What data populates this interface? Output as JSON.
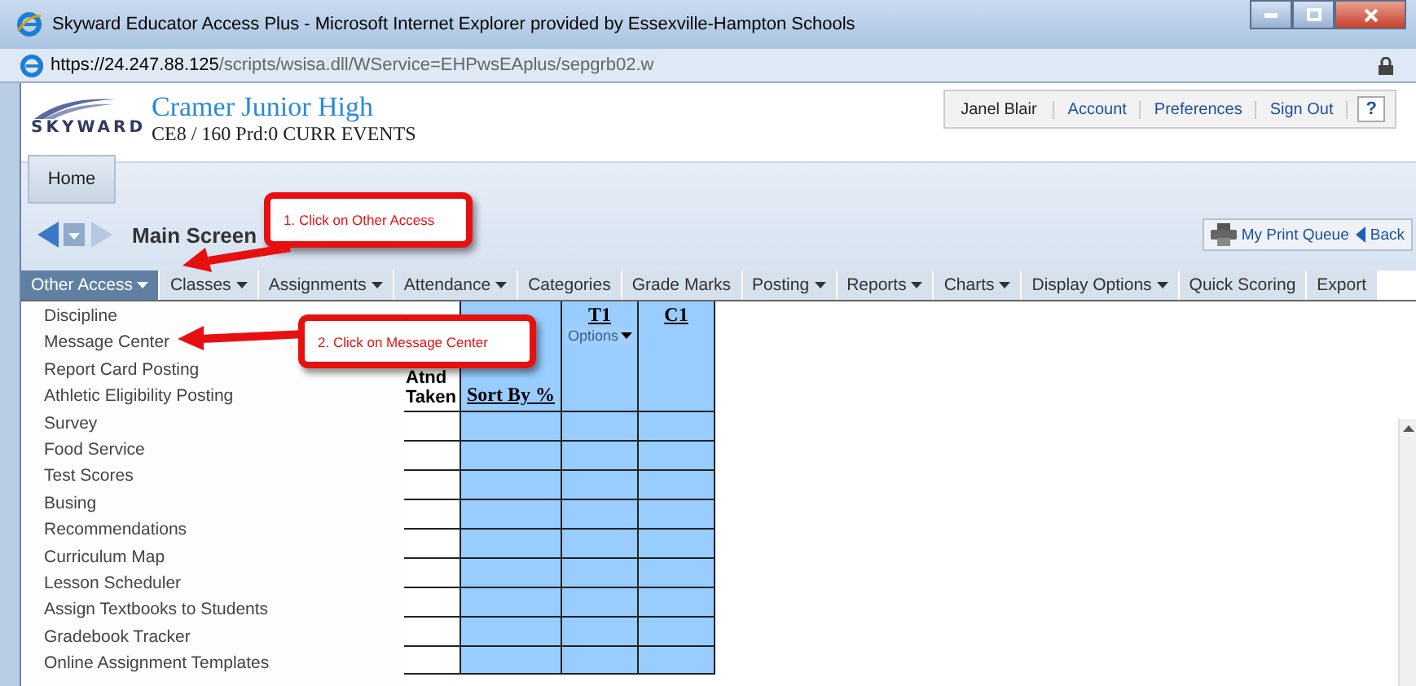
{
  "window": {
    "title": "Skyward Educator Access Plus - Microsoft Internet Explorer provided by Essexville-Hampton Schools"
  },
  "address_bar": {
    "url_host": "https://24.247.88.125",
    "url_path": "/scripts/wsisa.dll/WService=EHPwsEAplus/sepgrb02.w"
  },
  "header": {
    "logo": "SKYWARD",
    "school": "Cramer Junior High",
    "class_info": "CE8 / 160 Prd:0 CURR EVENTS",
    "user_links": [
      {
        "kind": "name",
        "label": "Janel Blair"
      },
      {
        "kind": "link",
        "label": "Account"
      },
      {
        "kind": "link",
        "label": "Preferences"
      },
      {
        "kind": "link",
        "label": "Sign Out"
      },
      {
        "kind": "help",
        "label": "?"
      }
    ]
  },
  "home_tab": "Home",
  "page_title": "Main Screen",
  "toolbar": {
    "print_queue": "My Print Queue",
    "back": "Back"
  },
  "menu": [
    {
      "label": "Other Access",
      "caret": true,
      "selected": true
    },
    {
      "label": "Classes",
      "caret": true,
      "selected": false
    },
    {
      "label": "Assignments",
      "caret": true,
      "selected": false
    },
    {
      "label": "Attendance",
      "caret": true,
      "selected": false
    },
    {
      "label": "Categories",
      "caret": false,
      "selected": false
    },
    {
      "label": "Grade Marks",
      "caret": false,
      "selected": false
    },
    {
      "label": "Posting",
      "caret": true,
      "selected": false
    },
    {
      "label": "Reports",
      "caret": true,
      "selected": false
    },
    {
      "label": "Charts",
      "caret": true,
      "selected": false
    },
    {
      "label": "Display Options",
      "caret": true,
      "selected": false
    },
    {
      "label": "Quick Scoring",
      "caret": false,
      "selected": false
    },
    {
      "label": "Export",
      "caret": false,
      "selected": false
    }
  ],
  "dropdown": [
    "Discipline",
    "Message Center",
    "Report Card Posting",
    "Athletic Eligibility Posting",
    "Survey",
    "Food Service",
    "Test Scores",
    "Busing",
    "Recommendations",
    "Curriculum Map",
    "Lesson Scheduler",
    "Assign Textbooks to Students",
    "Gradebook Tracker",
    "Online Assignment Templates"
  ],
  "grid": {
    "atnd_header": [
      "Atnd",
      "Taken"
    ],
    "sort_link": "Sort By %",
    "t1": "T1",
    "t1_options": "Options",
    "c1": "C1"
  },
  "callouts": [
    {
      "text": "1. Click on Other Access"
    },
    {
      "text": "2. Click on Message Center"
    }
  ]
}
